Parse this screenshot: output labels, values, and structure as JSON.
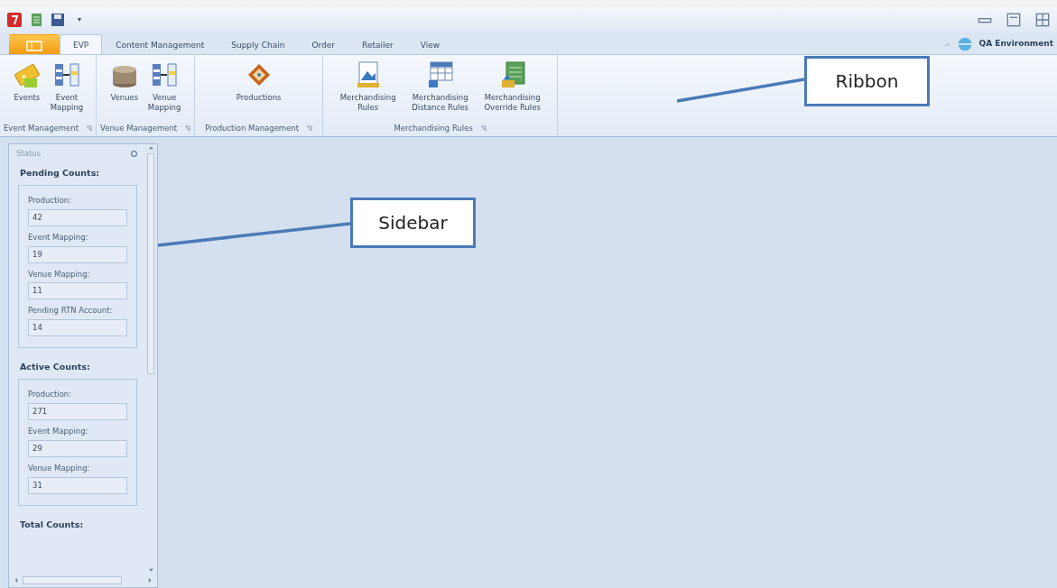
{
  "window": {
    "quick_access_menu": "▾"
  },
  "tabs": [
    {
      "kind": "file",
      "selected": false
    },
    {
      "kind": "tab",
      "label": "EVP",
      "selected": true
    },
    {
      "kind": "tab",
      "label": "Content Management",
      "selected": false
    },
    {
      "kind": "tab",
      "label": "Supply Chain",
      "selected": false
    },
    {
      "kind": "tab",
      "label": "Order",
      "selected": false
    },
    {
      "kind": "tab",
      "label": "Retailer",
      "selected": false
    },
    {
      "kind": "tab",
      "label": "View",
      "selected": false
    }
  ],
  "environment": "QA Environment",
  "ribbon_groups": [
    {
      "label": "Event Management",
      "buttons": [
        {
          "kind": "ticket",
          "label": "Events"
        },
        {
          "kind": "mapping",
          "label": "Event Mapping"
        }
      ]
    },
    {
      "label": "Venue Management",
      "buttons": [
        {
          "kind": "venue",
          "label": "Venues"
        },
        {
          "kind": "mapping",
          "label": "Venue Mapping"
        }
      ]
    },
    {
      "label": "Production Management",
      "buttons": [
        {
          "kind": "production",
          "label": "Productions"
        }
      ]
    },
    {
      "label": "Merchandising Rules",
      "buttons": [
        {
          "kind": "doc",
          "label": "Merchandising Rules"
        },
        {
          "kind": "grid",
          "label": "Merchandising Distance Rules"
        },
        {
          "kind": "sheet",
          "label": "Merchandising Override Rules"
        }
      ]
    }
  ],
  "sidebar": {
    "title": "Status",
    "sections": [
      {
        "title": "Pending Counts:",
        "fields": [
          {
            "label": "Production:",
            "value": "42"
          },
          {
            "label": "Event Mapping:",
            "value": "19"
          },
          {
            "label": "Venue Mapping:",
            "value": "11"
          },
          {
            "label": "Pending RTN Account:",
            "value": "14"
          }
        ]
      },
      {
        "title": "Active Counts:",
        "fields": [
          {
            "label": "Production:",
            "value": "271"
          },
          {
            "label": "Event Mapping:",
            "value": "29"
          },
          {
            "label": "Venue Mapping:",
            "value": "31"
          }
        ]
      },
      {
        "title": "Total Counts:"
      }
    ]
  },
  "callouts": [
    {
      "text": "Ribbon"
    },
    {
      "text": "Sidebar"
    }
  ]
}
